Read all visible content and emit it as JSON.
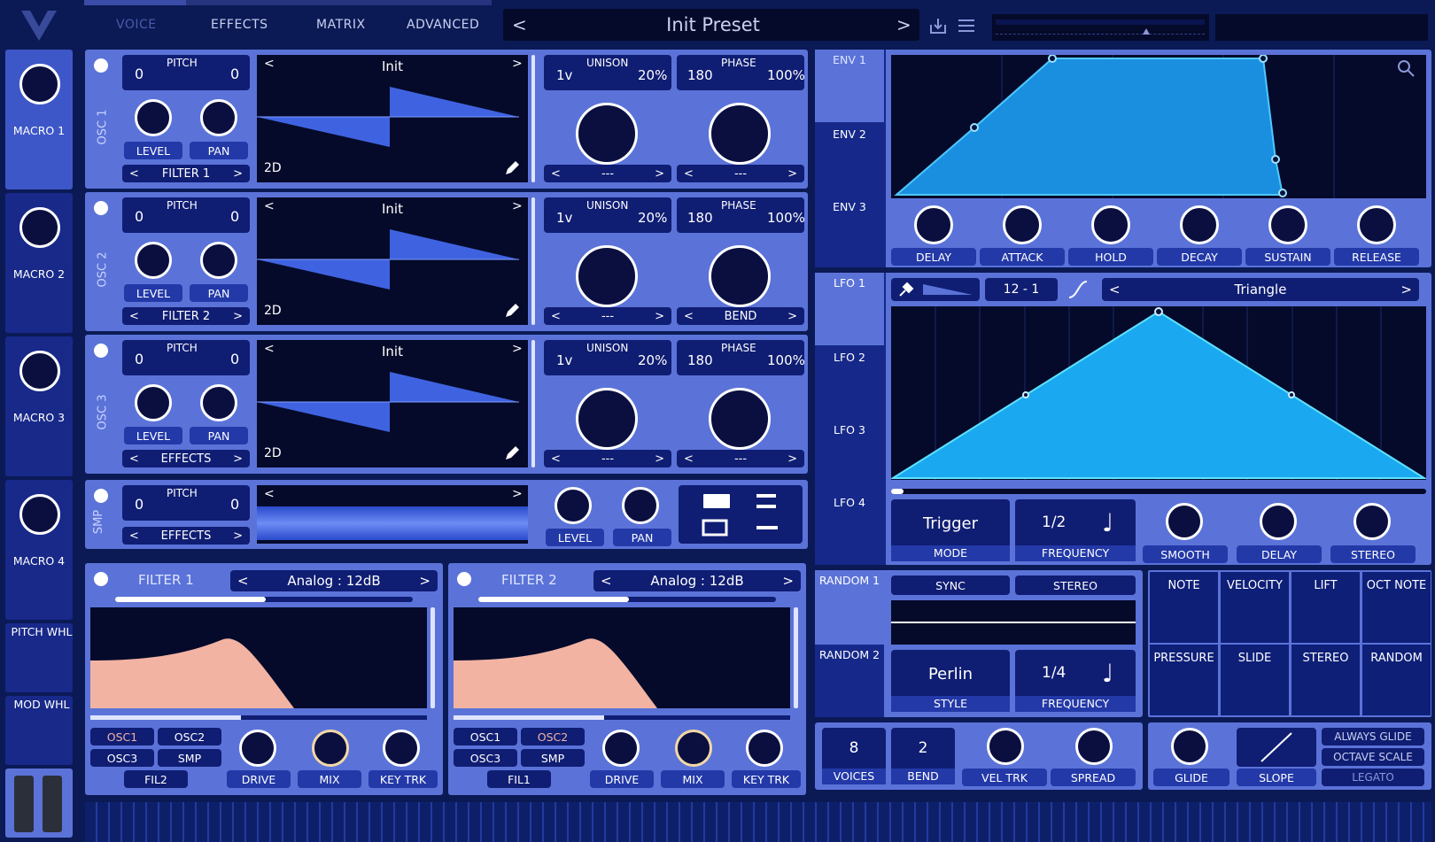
{
  "top_tabs": [
    "VOICE",
    "EFFECTS",
    "MATRIX",
    "ADVANCED"
  ],
  "preset": {
    "name": "Init Preset",
    "prev": "<",
    "next": ">"
  },
  "macros": [
    "MACRO 1",
    "MACRO 2",
    "MACRO 3",
    "MACRO 4"
  ],
  "wheels": [
    "PITCH WHL",
    "MOD WHL"
  ],
  "osc": [
    {
      "label": "OSC 1",
      "pitch_label": "PITCH",
      "pitch_l": "0",
      "pitch_r": "0",
      "level": "LEVEL",
      "pan": "PAN",
      "dest": "FILTER 1",
      "wave": "Init",
      "dim": "2D",
      "unison": "UNISON",
      "uni_v": "1v",
      "uni_p": "20%",
      "phase": "PHASE",
      "ph_v": "180",
      "ph_p": "100%",
      "sel_a": "---",
      "sel_b": "---"
    },
    {
      "label": "OSC 2",
      "pitch_label": "PITCH",
      "pitch_l": "0",
      "pitch_r": "0",
      "level": "LEVEL",
      "pan": "PAN",
      "dest": "FILTER 2",
      "wave": "Init",
      "dim": "2D",
      "unison": "UNISON",
      "uni_v": "1v",
      "uni_p": "20%",
      "phase": "PHASE",
      "ph_v": "180",
      "ph_p": "100%",
      "sel_a": "---",
      "sel_b": "BEND"
    },
    {
      "label": "OSC 3",
      "pitch_label": "PITCH",
      "pitch_l": "0",
      "pitch_r": "0",
      "level": "LEVEL",
      "pan": "PAN",
      "dest": "EFFECTS",
      "wave": "Init",
      "dim": "2D",
      "unison": "UNISON",
      "uni_v": "1v",
      "uni_p": "20%",
      "phase": "PHASE",
      "ph_v": "180",
      "ph_p": "100%",
      "sel_a": "---",
      "sel_b": "---"
    }
  ],
  "smp": {
    "label": "SMP",
    "pitch_label": "PITCH",
    "pitch_l": "0",
    "pitch_r": "0",
    "dest": "EFFECTS",
    "level": "LEVEL",
    "pan": "PAN"
  },
  "filters": [
    {
      "title": "FILTER 1",
      "type": "Analog : 12dB",
      "src": [
        "OSC1",
        "OSC2",
        "OSC3",
        "SMP"
      ],
      "fil": "FIL2",
      "drive": "DRIVE",
      "mix": "MIX",
      "key": "KEY TRK"
    },
    {
      "title": "FILTER 2",
      "type": "Analog : 12dB",
      "src": [
        "OSC1",
        "OSC2",
        "OSC3",
        "SMP"
      ],
      "fil": "FIL1",
      "drive": "DRIVE",
      "mix": "MIX",
      "key": "KEY TRK"
    }
  ],
  "env": {
    "tabs": [
      "ENV 1",
      "ENV 2",
      "ENV 3"
    ],
    "knobs": [
      "DELAY",
      "ATTACK",
      "HOLD",
      "DECAY",
      "SUSTAIN",
      "RELEASE"
    ]
  },
  "lfo": {
    "tabs": [
      "LFO 1",
      "LFO 2",
      "LFO 3",
      "LFO 4"
    ],
    "grid": "12  -  1",
    "shape": "Triangle",
    "mode": "Trigger",
    "mode_lbl": "MODE",
    "freq": "1/2",
    "freq_lbl": "FREQUENCY",
    "smooth": "SMOOTH",
    "delay": "DELAY",
    "stereo": "STEREO"
  },
  "random": {
    "tabs": [
      "RANDOM 1",
      "RANDOM 2"
    ],
    "sync": "SYNC",
    "stereo": "STEREO",
    "style": "Perlin",
    "style_lbl": "STYLE",
    "freq": "1/4",
    "freq_lbl": "FREQUENCY"
  },
  "mod_sources": [
    "NOTE",
    "VELOCITY",
    "LIFT",
    "OCT NOTE",
    "PRESSURE",
    "SLIDE",
    "STEREO",
    "RANDOM"
  ],
  "voice": {
    "voices": "8",
    "voices_lbl": "VOICES",
    "bend": "2",
    "bend_lbl": "BEND",
    "vel": "VEL TRK",
    "spread": "SPREAD",
    "glide": "GLIDE",
    "slope": "SLOPE",
    "always": "ALWAYS GLIDE",
    "octave": "OCTAVE SCALE",
    "legato": "LEGATO"
  }
}
